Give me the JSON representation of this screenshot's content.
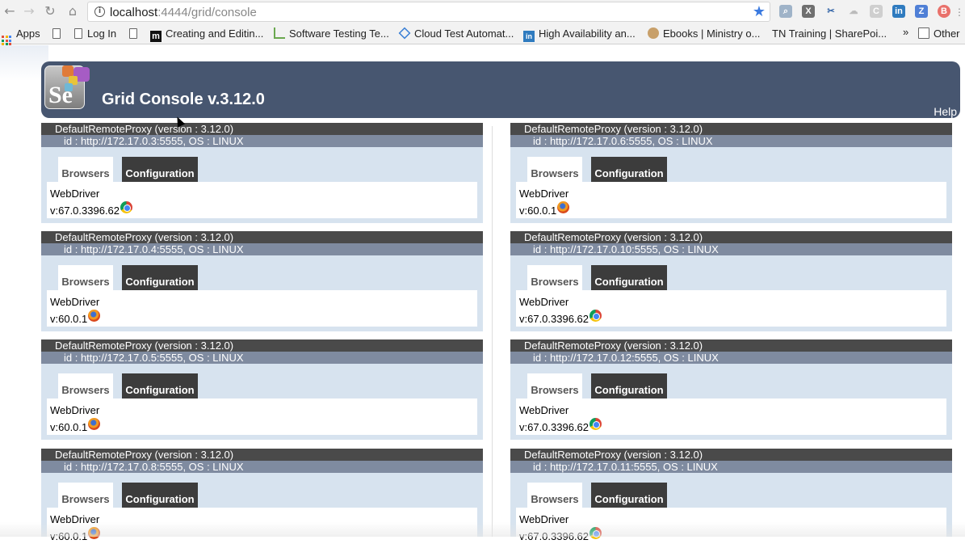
{
  "browser": {
    "url_host": "localhost",
    "url_path": ":4444/grid/console",
    "bookmarks": [
      {
        "label": "Apps"
      },
      {
        "label": ""
      },
      {
        "label": "Log In"
      },
      {
        "label": ""
      },
      {
        "label": "Creating and Editin..."
      },
      {
        "label": "Software Testing Te..."
      },
      {
        "label": "Cloud Test Automat..."
      },
      {
        "label": "High Availability an..."
      },
      {
        "label": "Ebooks | Ministry o..."
      },
      {
        "label": "TN Training | SharePoi..."
      }
    ],
    "overflow": "»",
    "other_label": "Other"
  },
  "header": {
    "title": "Grid Console v.3.12.0",
    "help": "Help",
    "logo_text": "Se"
  },
  "tabs": {
    "browsers": "Browsers",
    "configuration": "Configuration"
  },
  "proxies": [
    {
      "title": "DefaultRemoteProxy (version : 3.12.0)",
      "id": "id : http://172.17.0.3:5555, OS : LINUX",
      "driver": "WebDriver",
      "version": "v:67.0.3396.62",
      "browser_icon": "chrome-icon"
    },
    {
      "title": "DefaultRemoteProxy (version : 3.12.0)",
      "id": "id : http://172.17.0.6:5555, OS : LINUX",
      "driver": "WebDriver",
      "version": "v:60.0.1",
      "browser_icon": "firefox-icon"
    },
    {
      "title": "DefaultRemoteProxy (version : 3.12.0)",
      "id": "id : http://172.17.0.4:5555, OS : LINUX",
      "driver": "WebDriver",
      "version": "v:60.0.1",
      "browser_icon": "firefox-icon"
    },
    {
      "title": "DefaultRemoteProxy (version : 3.12.0)",
      "id": "id : http://172.17.0.10:5555, OS : LINUX",
      "driver": "WebDriver",
      "version": "v:67.0.3396.62",
      "browser_icon": "chrome-icon"
    },
    {
      "title": "DefaultRemoteProxy (version : 3.12.0)",
      "id": "id : http://172.17.0.5:5555, OS : LINUX",
      "driver": "WebDriver",
      "version": "v:60.0.1",
      "browser_icon": "firefox-icon"
    },
    {
      "title": "DefaultRemoteProxy (version : 3.12.0)",
      "id": "id : http://172.17.0.12:5555, OS : LINUX",
      "driver": "WebDriver",
      "version": "v:67.0.3396.62",
      "browser_icon": "chrome-icon"
    },
    {
      "title": "DefaultRemoteProxy (version : 3.12.0)",
      "id": "id : http://172.17.0.8:5555, OS : LINUX",
      "driver": "WebDriver",
      "version": "v:60.0.1",
      "browser_icon": "firefox-icon"
    },
    {
      "title": "DefaultRemoteProxy (version : 3.12.0)",
      "id": "id : http://172.17.0.11:5555, OS : LINUX",
      "driver": "WebDriver",
      "version": "v:67.0.3396.62",
      "browser_icon": "chrome-icon"
    }
  ]
}
